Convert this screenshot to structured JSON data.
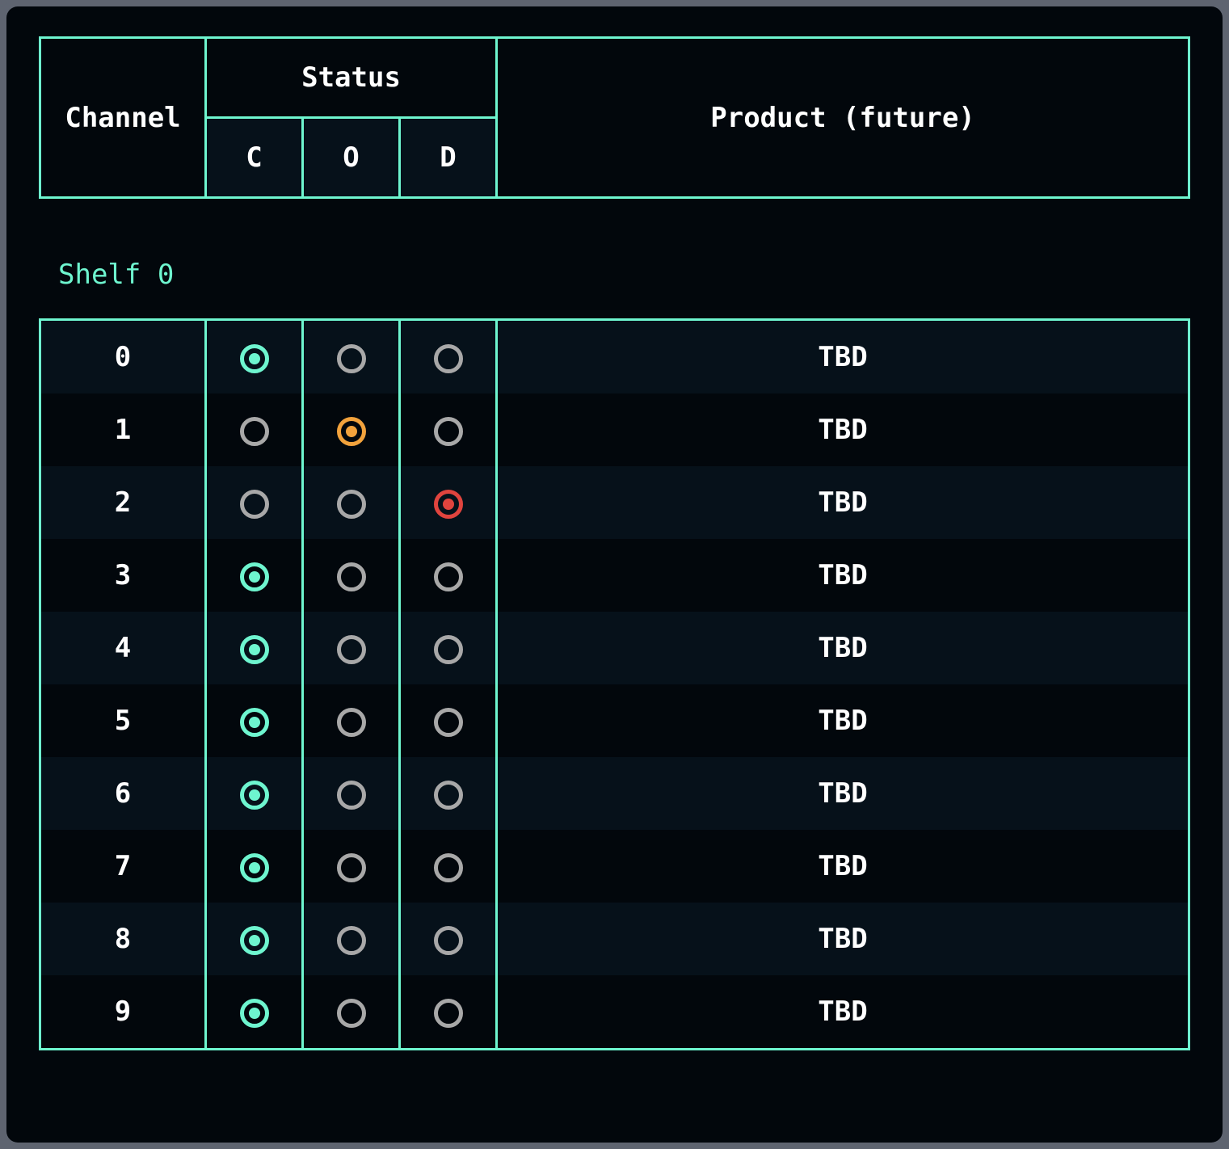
{
  "colors": {
    "accent": "#6ef5cf",
    "status_c": "#6ef5cf",
    "status_o": "#f2a23c",
    "status_d": "#e0443e",
    "inactive": "#a8a8a8"
  },
  "header": {
    "channel": "Channel",
    "status": "Status",
    "status_cols": [
      "C",
      "O",
      "D"
    ],
    "product": "Product (future)"
  },
  "shelf": {
    "label": "Shelf 0",
    "rows": [
      {
        "channel": "0",
        "status": "C",
        "product": "TBD"
      },
      {
        "channel": "1",
        "status": "O",
        "product": "TBD"
      },
      {
        "channel": "2",
        "status": "D",
        "product": "TBD"
      },
      {
        "channel": "3",
        "status": "C",
        "product": "TBD"
      },
      {
        "channel": "4",
        "status": "C",
        "product": "TBD"
      },
      {
        "channel": "5",
        "status": "C",
        "product": "TBD"
      },
      {
        "channel": "6",
        "status": "C",
        "product": "TBD"
      },
      {
        "channel": "7",
        "status": "C",
        "product": "TBD"
      },
      {
        "channel": "8",
        "status": "C",
        "product": "TBD"
      },
      {
        "channel": "9",
        "status": "C",
        "product": "TBD"
      }
    ]
  }
}
